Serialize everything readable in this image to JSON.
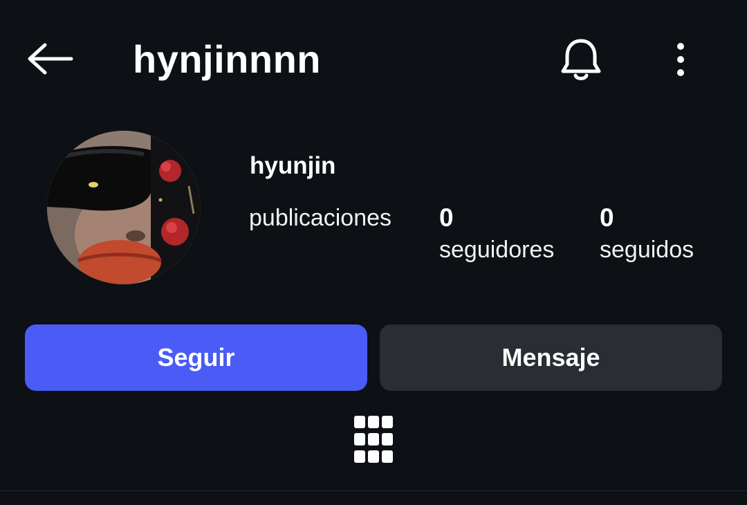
{
  "header": {
    "username": "hynjinnnn",
    "back_icon": "arrow-left-icon",
    "bell_icon": "bell-icon",
    "more_icon": "more-vertical-icon"
  },
  "profile": {
    "display_name": "hyunjin",
    "avatar_icon": "profile-avatar-photo",
    "stats": [
      {
        "value": "",
        "label": "publicaciones"
      },
      {
        "value": "0",
        "label": "seguidores"
      },
      {
        "value": "0",
        "label": "seguidos"
      }
    ]
  },
  "actions": {
    "follow_label": "Seguir",
    "message_label": "Mensaje"
  },
  "tabs": {
    "grid_icon": "grid-icon"
  },
  "colors": {
    "background": "#0d1014",
    "accent": "#4a5cf5",
    "secondary_button": "#2a2d33",
    "text": "#ffffff"
  }
}
